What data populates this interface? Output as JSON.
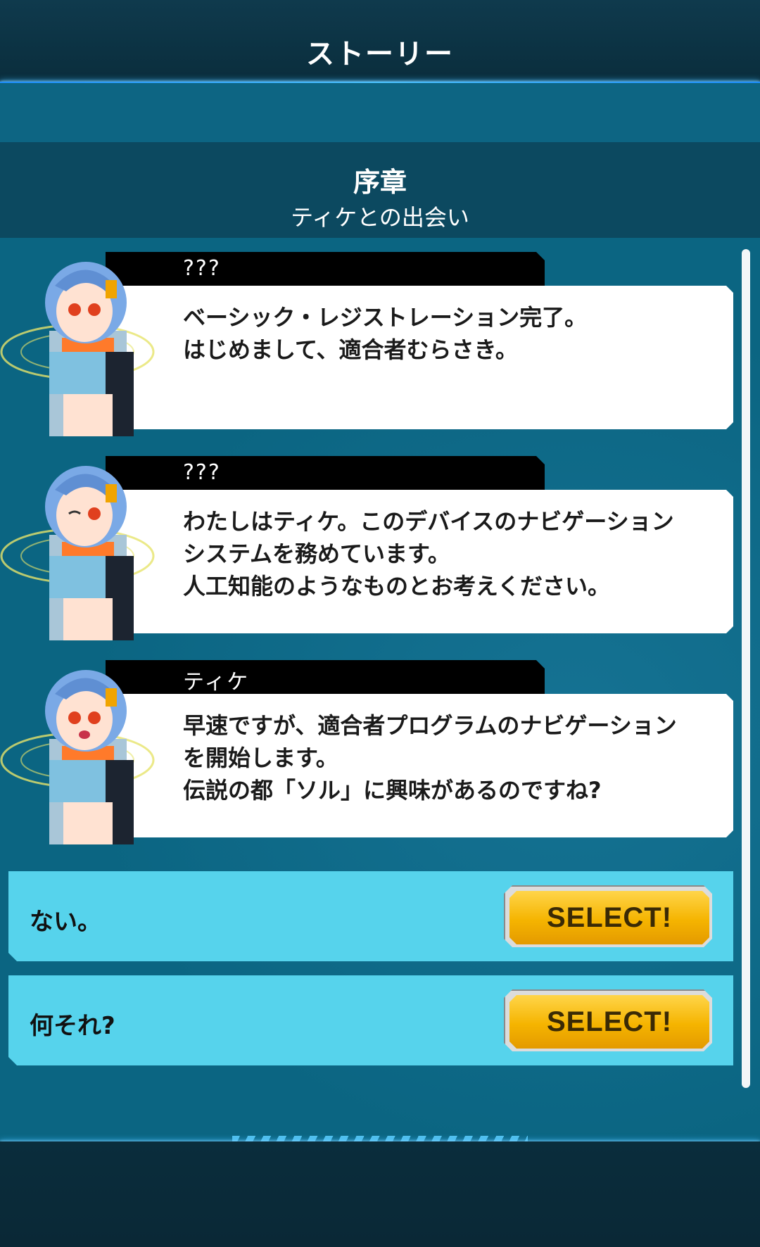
{
  "header": {
    "title": "ストーリー"
  },
  "chapter": {
    "number": "序章",
    "subtitle": "ティケとの出会い"
  },
  "messages": [
    {
      "speaker": "???",
      "text": "ベーシック・レジストレーション完了。\nはじめまして、適合者むらさき。"
    },
    {
      "speaker": "???",
      "text": "わたしはティケ。このデバイスのナビゲーション\nシステムを務めています。\n人工知能のようなものとお考えください。"
    },
    {
      "speaker": "ティケ",
      "text": "早速ですが、適合者プログラムのナビゲーション\nを開始します。\n伝説の都「ソル」に興味があるのですね?"
    }
  ],
  "choices": [
    {
      "label": "ない。",
      "button": "SELECT!"
    },
    {
      "label": "何それ?",
      "button": "SELECT!"
    }
  ],
  "colors": {
    "accent": "#56d3ec",
    "button": "#f5b400",
    "background": "#0b6582"
  },
  "icons": {
    "portrait": "character-portrait-icon"
  }
}
